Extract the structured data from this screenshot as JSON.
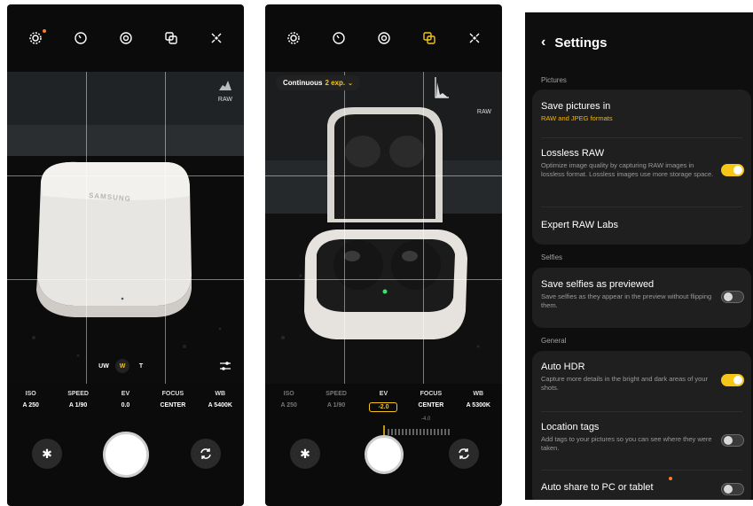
{
  "phone1": {
    "raw_label": "RAW",
    "case_brand": "SAMSUNG",
    "zoom": [
      "UW",
      "W",
      "T"
    ],
    "settings": [
      {
        "label": "ISO",
        "value": "A 250"
      },
      {
        "label": "SPEED",
        "value": "A 1/90"
      },
      {
        "label": "EV",
        "value": "0.0"
      },
      {
        "label": "FOCUS",
        "value": "CENTER"
      },
      {
        "label": "WB",
        "value": "A 5400K"
      }
    ]
  },
  "phone2": {
    "continuous_prefix": "Continuous",
    "continuous_value": "2 exp.",
    "raw_label": "RAW",
    "settings": [
      {
        "label": "ISO",
        "value": "A 250"
      },
      {
        "label": "SPEED",
        "value": "A 1/90"
      },
      {
        "label": "EV",
        "value": "-2.0"
      },
      {
        "label": "FOCUS",
        "value": "CENTER"
      },
      {
        "label": "WB",
        "value": "A 5300K"
      }
    ],
    "ev_scale_label": "-4.0"
  },
  "settings": {
    "title": "Settings",
    "sections": {
      "pictures": "Pictures",
      "selfies": "Selfies",
      "general": "General"
    },
    "items": {
      "save_pictures": {
        "title": "Save pictures in",
        "sub": "RAW and JPEG formats"
      },
      "lossless_raw": {
        "title": "Lossless RAW",
        "sub": "Optimize image quality by capturing RAW images in lossless format. Lossless images use more storage space.",
        "on": true
      },
      "expert_raw": {
        "title": "Expert RAW Labs"
      },
      "save_selfies": {
        "title": "Save selfies as previewed",
        "sub": "Save selfies as they appear in the preview without flipping them.",
        "on": false
      },
      "auto_hdr": {
        "title": "Auto HDR",
        "sub": "Capture more details in the bright and dark areas of your shots.",
        "on": true
      },
      "location_tags": {
        "title": "Location tags",
        "sub": "Add tags to your pictures so you can see where they were taken.",
        "on": false
      },
      "auto_share": {
        "title": "Auto share to PC or tablet",
        "on": false
      }
    }
  }
}
